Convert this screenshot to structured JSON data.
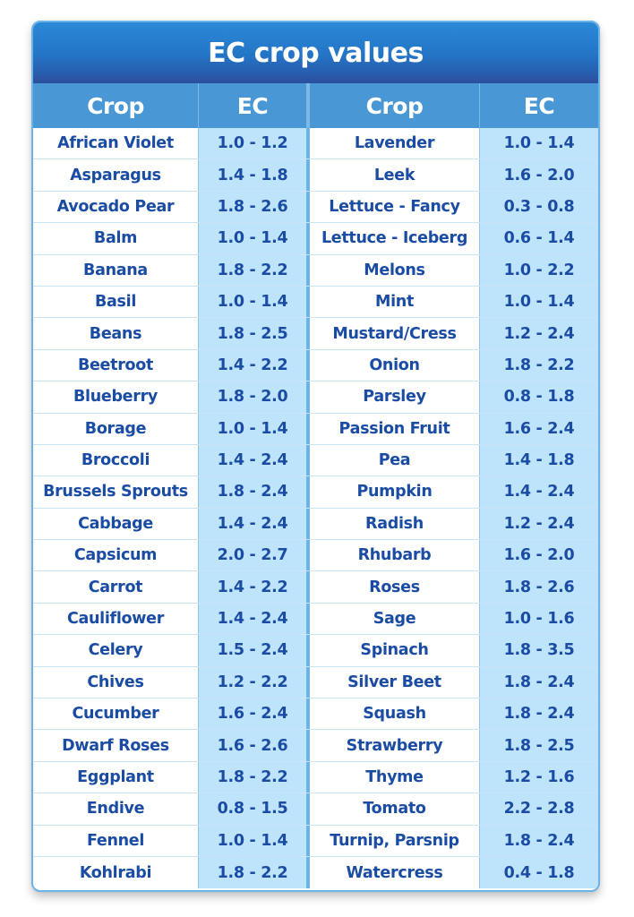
{
  "title": "EC crop values",
  "headers": {
    "crop_left": "Crop",
    "ec_left": "EC",
    "crop_right": "Crop",
    "ec_right": "EC"
  },
  "colors": {
    "title_bg": "#2474c6",
    "header_bg": "#4a97d6",
    "ec_column_bg": "#bde4fa",
    "text": "#1a4ca3",
    "border": "#6cb3e8"
  },
  "rows": [
    {
      "left_crop": "African Violet",
      "left_ec": "1.0 - 1.2",
      "right_crop": "Lavender",
      "right_ec": "1.0 - 1.4"
    },
    {
      "left_crop": "Asparagus",
      "left_ec": "1.4 - 1.8",
      "right_crop": "Leek",
      "right_ec": "1.6 - 2.0"
    },
    {
      "left_crop": "Avocado Pear",
      "left_ec": "1.8 - 2.6",
      "right_crop": "Lettuce - Fancy",
      "right_ec": "0.3 - 0.8"
    },
    {
      "left_crop": "Balm",
      "left_ec": "1.0 - 1.4",
      "right_crop": "Lettuce - Iceberg",
      "right_ec": "0.6 - 1.4"
    },
    {
      "left_crop": "Banana",
      "left_ec": "1.8 - 2.2",
      "right_crop": "Melons",
      "right_ec": "1.0 - 2.2"
    },
    {
      "left_crop": "Basil",
      "left_ec": "1.0 - 1.4",
      "right_crop": "Mint",
      "right_ec": "1.0 - 1.4"
    },
    {
      "left_crop": "Beans",
      "left_ec": "1.8 - 2.5",
      "right_crop": "Mustard/Cress",
      "right_ec": "1.2 - 2.4"
    },
    {
      "left_crop": "Beetroot",
      "left_ec": "1.4 - 2.2",
      "right_crop": "Onion",
      "right_ec": "1.8 - 2.2"
    },
    {
      "left_crop": "Blueberry",
      "left_ec": "1.8 - 2.0",
      "right_crop": "Parsley",
      "right_ec": "0.8 - 1.8"
    },
    {
      "left_crop": "Borage",
      "left_ec": "1.0 - 1.4",
      "right_crop": "Passion Fruit",
      "right_ec": "1.6 - 2.4"
    },
    {
      "left_crop": "Broccoli",
      "left_ec": "1.4 - 2.4",
      "right_crop": "Pea",
      "right_ec": "1.4 - 1.8"
    },
    {
      "left_crop": "Brussels Sprouts",
      "left_ec": "1.8 - 2.4",
      "right_crop": "Pumpkin",
      "right_ec": "1.4 - 2.4"
    },
    {
      "left_crop": "Cabbage",
      "left_ec": "1.4 - 2.4",
      "right_crop": "Radish",
      "right_ec": "1.2 - 2.4"
    },
    {
      "left_crop": "Capsicum",
      "left_ec": "2.0 - 2.7",
      "right_crop": "Rhubarb",
      "right_ec": "1.6 - 2.0"
    },
    {
      "left_crop": "Carrot",
      "left_ec": "1.4 - 2.2",
      "right_crop": "Roses",
      "right_ec": "1.8 - 2.6"
    },
    {
      "left_crop": "Cauliflower",
      "left_ec": "1.4 - 2.4",
      "right_crop": "Sage",
      "right_ec": "1.0 - 1.6"
    },
    {
      "left_crop": "Celery",
      "left_ec": "1.5 - 2.4",
      "right_crop": "Spinach",
      "right_ec": "1.8 - 3.5"
    },
    {
      "left_crop": "Chives",
      "left_ec": "1.2 - 2.2",
      "right_crop": "Silver Beet",
      "right_ec": "1.8 - 2.4"
    },
    {
      "left_crop": "Cucumber",
      "left_ec": "1.6 - 2.4",
      "right_crop": "Squash",
      "right_ec": "1.8 - 2.4"
    },
    {
      "left_crop": "Dwarf Roses",
      "left_ec": "1.6 - 2.6",
      "right_crop": "Strawberry",
      "right_ec": "1.8 - 2.5"
    },
    {
      "left_crop": "Eggplant",
      "left_ec": "1.8 - 2.2",
      "right_crop": "Thyme",
      "right_ec": "1.2 - 1.6"
    },
    {
      "left_crop": "Endive",
      "left_ec": "0.8 - 1.5",
      "right_crop": "Tomato",
      "right_ec": "2.2 - 2.8"
    },
    {
      "left_crop": "Fennel",
      "left_ec": "1.0 - 1.4",
      "right_crop": "Turnip, Parsnip",
      "right_ec": "1.8 - 2.4"
    },
    {
      "left_crop": "Kohlrabi",
      "left_ec": "1.8 - 2.2",
      "right_crop": "Watercress",
      "right_ec": "0.4 - 1.8"
    }
  ]
}
